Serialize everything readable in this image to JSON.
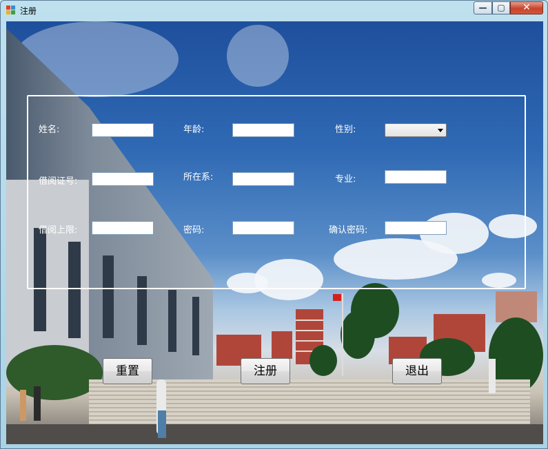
{
  "window": {
    "title": "注册",
    "controls": {
      "minimize": "—",
      "maximize": "▢",
      "close": "✕"
    }
  },
  "form": {
    "labels": {
      "name": "姓名:",
      "age": "年龄:",
      "gender": "性别:",
      "card_no": "借阅证号:",
      "department": "所在系:",
      "major": "专业:",
      "borrow_limit": "借阅上限:",
      "password": "密码:",
      "confirm_password": "确认密码:"
    },
    "values": {
      "name": "",
      "age": "",
      "gender": "",
      "card_no": "",
      "department": "",
      "major": "",
      "borrow_limit": "",
      "password": "",
      "confirm_password": ""
    }
  },
  "buttons": {
    "reset": "重置",
    "register": "注册",
    "exit": "退出"
  },
  "colors": {
    "label_text": "#ffffff",
    "group_border": "#ffffff",
    "close_button": "#c7432b"
  }
}
